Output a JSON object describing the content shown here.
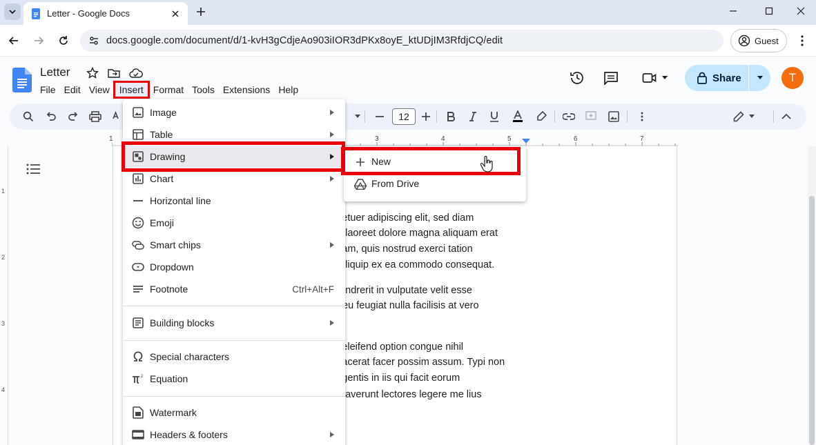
{
  "browser": {
    "tab_title": "Letter - Google Docs",
    "url": "docs.google.com/document/d/1-kvH3gCdjeAo903iIOR3dPKx8oyE_ktUDjIM3RfdjCQ/edit",
    "guest_label": "Guest"
  },
  "doc": {
    "title": "Letter",
    "menus": [
      "File",
      "Edit",
      "View",
      "Insert",
      "Format",
      "Tools",
      "Extensions",
      "Help"
    ],
    "active_menu": "Insert",
    "share_label": "Share",
    "avatar_letter": "T"
  },
  "toolbar": {
    "font_size": "12"
  },
  "ruler": {
    "numbers": [
      "1",
      "3",
      "4",
      "5",
      "6",
      "7"
    ],
    "vertical_numbers": [
      "1",
      "2",
      "3",
      "4"
    ]
  },
  "insert_menu": {
    "items": [
      {
        "label": "Image",
        "icon": "image-icon",
        "submenu": true
      },
      {
        "label": "Table",
        "icon": "table-icon",
        "submenu": true
      },
      {
        "label": "Drawing",
        "icon": "drawing-icon",
        "submenu": true
      },
      {
        "label": "Chart",
        "icon": "chart-icon",
        "submenu": true
      },
      {
        "label": "Horizontal line",
        "icon": "horizontal-line-icon",
        "submenu": false
      },
      {
        "label": "Emoji",
        "icon": "emoji-icon",
        "submenu": false
      },
      {
        "label": "Smart chips",
        "icon": "smart-chips-icon",
        "submenu": true
      },
      {
        "label": "Dropdown",
        "icon": "dropdown-icon",
        "submenu": false
      },
      {
        "label": "Footnote",
        "icon": "footnote-icon",
        "submenu": false,
        "shortcut": "Ctrl+Alt+F"
      },
      {
        "label": "Building blocks",
        "icon": "building-blocks-icon",
        "submenu": true
      },
      {
        "label": "Special characters",
        "icon": "omega-icon",
        "submenu": false
      },
      {
        "label": "Equation",
        "icon": "pi-icon",
        "submenu": false
      },
      {
        "label": "Watermark",
        "icon": "watermark-icon",
        "submenu": false
      },
      {
        "label": "Headers & footers",
        "icon": "headers-footers-icon",
        "submenu": true
      }
    ]
  },
  "drawing_submenu": {
    "items": [
      {
        "label": "New",
        "icon": "plus-icon"
      },
      {
        "label": "From Drive",
        "icon": "drive-icon"
      }
    ]
  },
  "document_body": {
    "lines": [
      "ctetuer adipiscing elit, sed diam",
      "ut laoreet dolore magna aliquam erat",
      "niam, quis nostrud exerci tation",
      "t aliquip ex ea commodo consequat.",
      "hendrerit in vulputate velit esse",
      "e eu feugiat nulla facilisis at vero",
      "s eleifend option congue nihil",
      "placerat facer possim assum. Typi non",
      " legentis in iis qui facit eorum",
      "straverunt lectores legere me lius"
    ]
  },
  "colors": {
    "highlight_red": "#e8000b",
    "share_bg": "#c2e7ff",
    "avatar_bg": "#f56c0c",
    "docs_blue": "#4285f4"
  }
}
